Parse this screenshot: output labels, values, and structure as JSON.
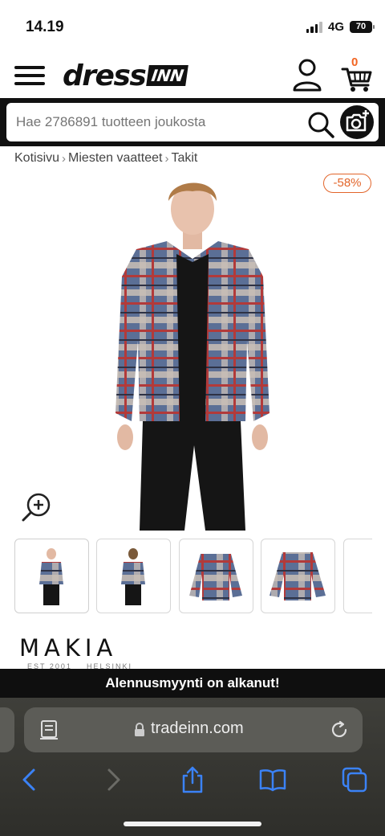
{
  "status_bar": {
    "time": "14.19",
    "network": "4G",
    "battery": "70"
  },
  "header": {
    "logo_main": "dress",
    "logo_box": "INN",
    "cart_count": "0"
  },
  "search": {
    "placeholder": "Hae 2786891 tuotteen joukosta"
  },
  "breadcrumb": [
    "Kotisivu",
    "Miesten vaatteet",
    "Takit"
  ],
  "product": {
    "discount": "-58%",
    "brand": "MAKIA",
    "brand_sub_left": "EST 2001",
    "brand_sub_right": "HELSINKI"
  },
  "thumbnails": [
    {
      "label": "model-front"
    },
    {
      "label": "model-back"
    },
    {
      "label": "jacket-front"
    },
    {
      "label": "jacket-back"
    },
    {
      "label": "more"
    }
  ],
  "promo": {
    "text": "Alennusmyynti on alkanut!"
  },
  "browser": {
    "url": "tradeinn.com"
  },
  "colors": {
    "accent_orange": "#f26522",
    "plaid_blue": "#5b6f96",
    "plaid_red": "#b23a3a"
  }
}
